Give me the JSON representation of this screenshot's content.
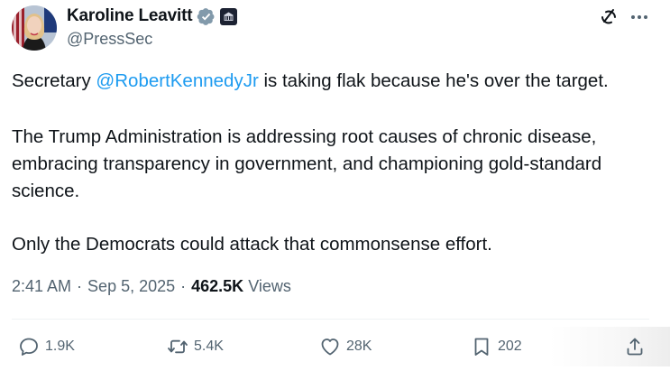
{
  "author": {
    "name": "Karoline Leavitt",
    "handle": "@PressSec"
  },
  "tweet": {
    "line1_pre": "Secretary ",
    "line1_mention": "@RobertKennedyJr",
    "line1_post": " is taking flak because he's over the target.",
    "para2_line1": "The Trump Administration is addressing root causes of chronic disease,",
    "para2_line2": "embracing transparency in government, and championing gold-standard",
    "para2_line3": "science.",
    "para3": "Only the Democrats could attack that commonsense effort."
  },
  "meta": {
    "time": "2:41 AM",
    "date": "Sep 5, 2025",
    "separator": "·",
    "views_count": "462.5K",
    "views_label": "Views"
  },
  "actions": {
    "replies": "1.9K",
    "reposts": "5.4K",
    "likes": "28K",
    "bookmarks": "202"
  },
  "colors": {
    "link": "#1d9bf0",
    "secondary": "#536471",
    "verified": "#829aab"
  },
  "icons": [
    "verified-badge-icon",
    "white-house-affiliate-icon",
    "grok-icon",
    "more-icon",
    "reply-icon",
    "repost-icon",
    "like-icon",
    "bookmark-icon",
    "share-icon"
  ]
}
